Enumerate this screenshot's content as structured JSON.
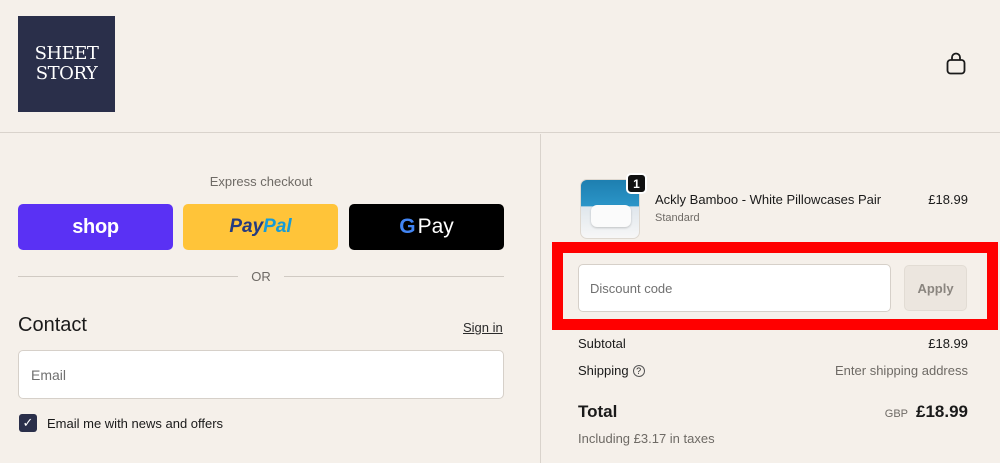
{
  "brand": {
    "line1": "SHEET",
    "line2": "STORY"
  },
  "header": {
    "cart_icon": "shopping-bag-icon"
  },
  "express_checkout": {
    "label": "Express checkout",
    "shop_label": "shop",
    "paypal_part1": "Pay",
    "paypal_part2": "Pal",
    "gpay_g": "G",
    "gpay_label": "Pay",
    "divider_label": "OR"
  },
  "contact": {
    "heading": "Contact",
    "signin_label": "Sign in",
    "email_placeholder": "Email",
    "email_value": "",
    "newsletter_checked": true,
    "newsletter_label": "Email me with news and offers"
  },
  "order": {
    "item": {
      "name": "Ackly Bamboo - White Pillowcases Pair",
      "variant": "Standard",
      "price": "£18.99",
      "quantity": "1"
    },
    "discount": {
      "placeholder": "Discount code",
      "apply_label": "Apply"
    },
    "subtotal_label": "Subtotal",
    "subtotal_value": "£18.99",
    "shipping_label": "Shipping",
    "shipping_info_icon": "?",
    "shipping_value": "Enter shipping address",
    "total_label": "Total",
    "currency": "GBP",
    "total_value": "£18.99",
    "taxes_note": "Including £3.17 in taxes"
  },
  "colors": {
    "background": "#f5f0ea",
    "brand_navy": "#2a2f4a",
    "shop_purple": "#5a31f4",
    "paypal_yellow": "#ffc439",
    "highlight_red": "#ff0000"
  }
}
